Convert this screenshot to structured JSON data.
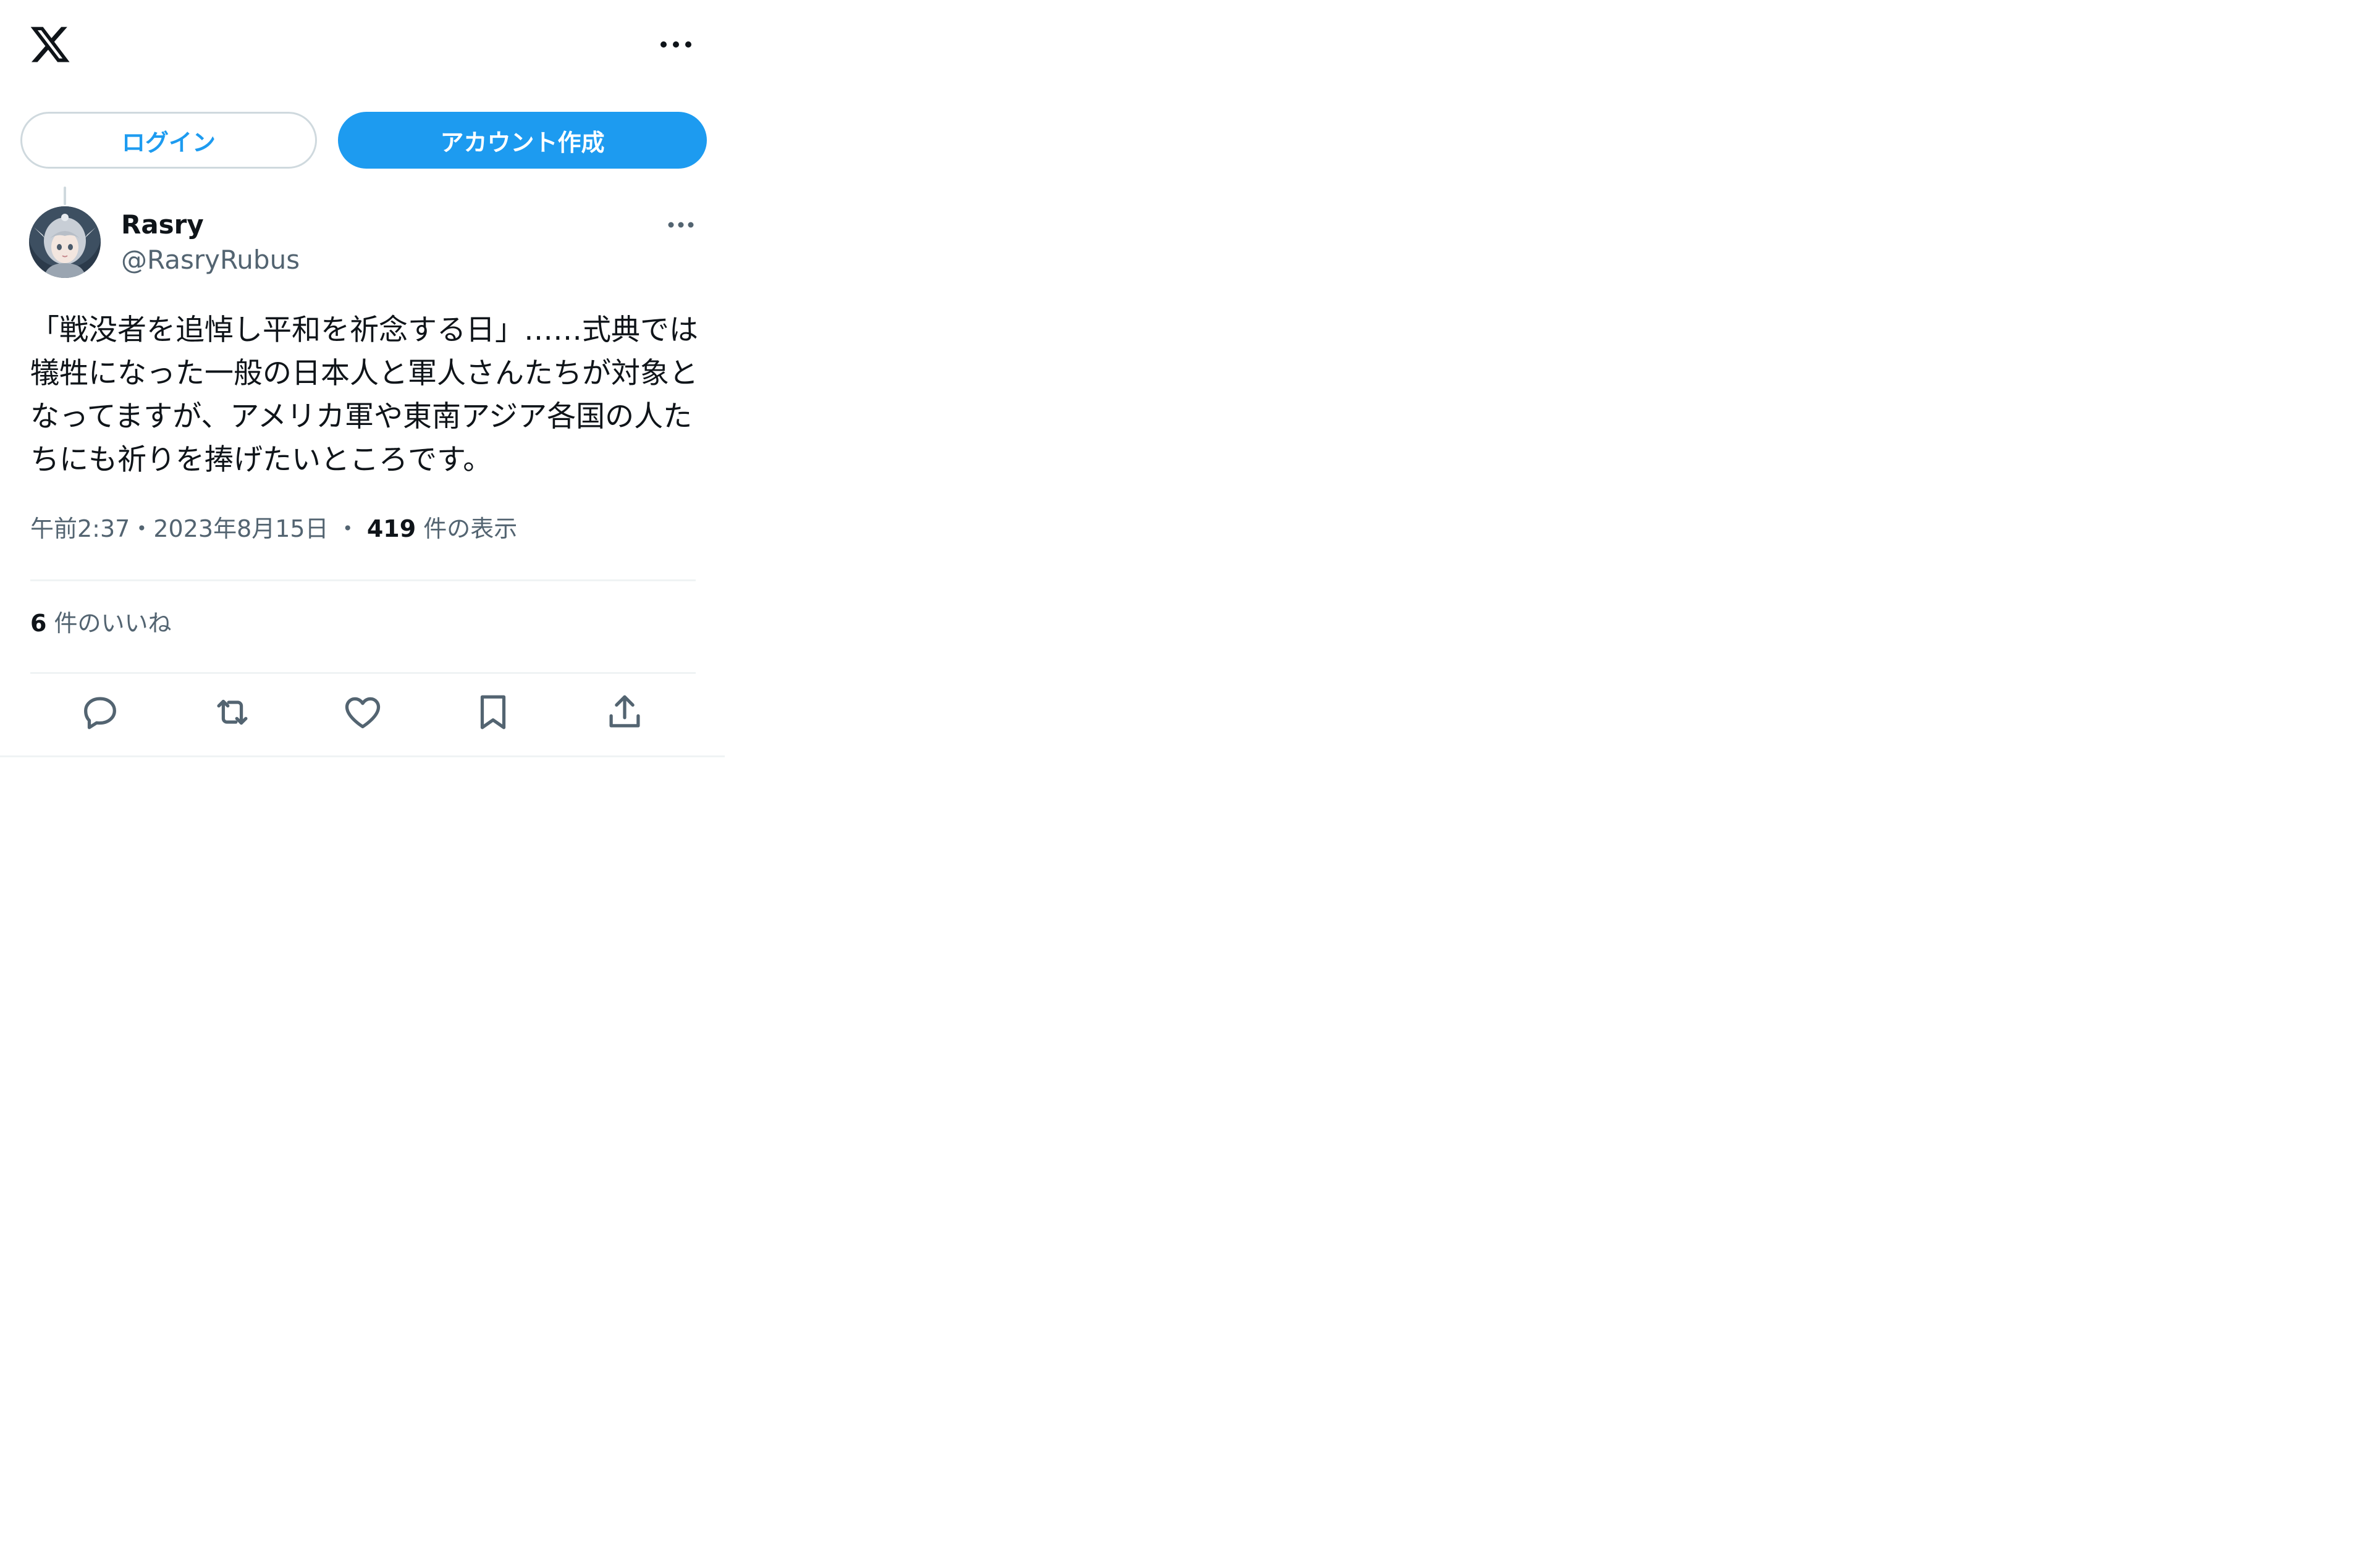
{
  "header": {
    "logo_icon": "x-logo-icon",
    "more_icon": "more-horizontal-icon"
  },
  "auth": {
    "login_label": "ログイン",
    "signup_label": "アカウント作成",
    "accent_color": "#1d9bf0"
  },
  "tweet": {
    "display_name": "Rasry",
    "handle": "@RasryRubus",
    "text": "「戦没者を追悼し平和を祈念する日」……式典では犠牲になった一般の日本人と軍人さんたちが対象となってますが、アメリカ軍や東南アジア各国の人たちにも祈りを捧げたいところです。",
    "time": "午前2:37",
    "separator1": "・",
    "date": "2023年8月15日",
    "separator2": "・",
    "views_count": "419",
    "views_label": "件の表示",
    "likes_count": "6",
    "likes_label": "件のいいね"
  },
  "actions": [
    {
      "icon": "reply-icon"
    },
    {
      "icon": "retweet-icon"
    },
    {
      "icon": "like-icon"
    },
    {
      "icon": "bookmark-icon"
    },
    {
      "icon": "share-icon"
    }
  ]
}
